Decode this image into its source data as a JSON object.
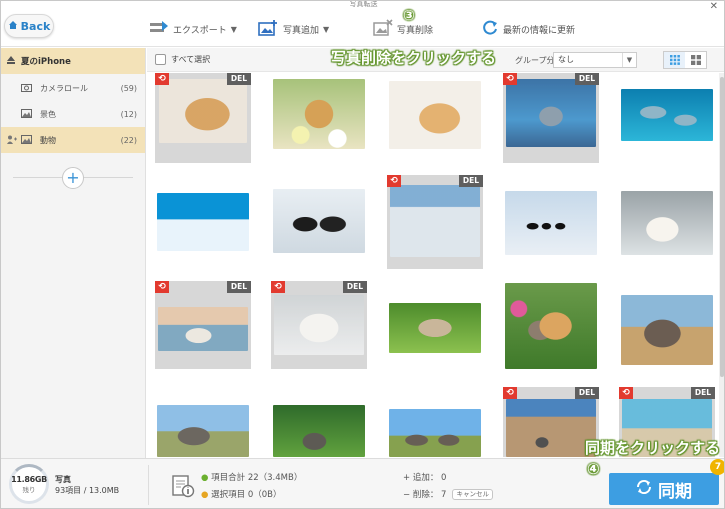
{
  "window": {
    "title": "写真転送",
    "close_glyph": "✕"
  },
  "toolbar": {
    "back_label": "Back",
    "export_label": "エクスポート",
    "add_photo_label": "写真追加",
    "delete_photo_label": "写真削除",
    "refresh_label": "最新の情報に更新"
  },
  "sidebar": {
    "device_name": "夏のiPhone",
    "items": [
      {
        "label": "カメラロール",
        "count": "(59)",
        "icon": "camera-icon"
      },
      {
        "label": "景色",
        "count": "(12)",
        "icon": "landscape-icon"
      },
      {
        "label": "動物",
        "count": "(22)",
        "icon": "animal-icon",
        "active": true
      }
    ],
    "add_glyph": "+"
  },
  "grid_header": {
    "select_all_label": "すべて選択",
    "group_label": "グループ分け：",
    "group_value": "なし",
    "group_dropdown_glyph": "▼"
  },
  "photos": {
    "undo_glyph": "⟲",
    "del_tag": "DEL",
    "items": [
      {
        "subject": "puppy",
        "deleted": true
      },
      {
        "subject": "puppy-flowers",
        "deleted": false
      },
      {
        "subject": "puppy-lying",
        "deleted": false
      },
      {
        "subject": "dolphin",
        "deleted": true
      },
      {
        "subject": "dolphins-jumping",
        "deleted": false
      },
      {
        "subject": "penguin-ice",
        "deleted": false
      },
      {
        "subject": "penguins-pair",
        "deleted": false
      },
      {
        "subject": "penguin-iceberg",
        "deleted": true
      },
      {
        "subject": "penguins-group",
        "deleted": false
      },
      {
        "subject": "polar-bear-cub",
        "deleted": false
      },
      {
        "subject": "polar-bears-water",
        "deleted": true
      },
      {
        "subject": "polar-bear-snow",
        "deleted": true
      },
      {
        "subject": "hedgehog",
        "deleted": false
      },
      {
        "subject": "kitten-puppy",
        "deleted": false
      },
      {
        "subject": "elephant",
        "deleted": false
      },
      {
        "subject": "elephants-savanna",
        "deleted": false
      },
      {
        "subject": "elephants-grass",
        "deleted": false
      },
      {
        "subject": "elephants-herd",
        "deleted": false
      },
      {
        "subject": "colosseum",
        "deleted": true
      },
      {
        "subject": "beach",
        "deleted": true
      }
    ]
  },
  "bottom": {
    "storage_free": "11.86GB",
    "storage_remaining_label": "残り",
    "category_label": "写真",
    "category_summary": "93項目 / 13.0MB",
    "total_label": "項目合計 22（3.4MB）",
    "selected_label": "選択項目 0（0B）",
    "added_label": "追加： 0",
    "deleted_label": "削除： 7",
    "cancel_label": "キャンセル",
    "sync_label": "同期",
    "sync_badge": "7",
    "bullet_glyph": "●",
    "plus_glyph": "+",
    "minus_glyph": "−"
  },
  "annotations": {
    "step3": "③",
    "delete_hint": "写真削除をクリックする",
    "sync_hint": "同期をクリックする",
    "step4": "④"
  },
  "colors": {
    "accent": "#3d9ee2",
    "active_row": "#f3e2b8",
    "delete_red": "#e23a2f",
    "hint_green": "#6d9f34"
  }
}
